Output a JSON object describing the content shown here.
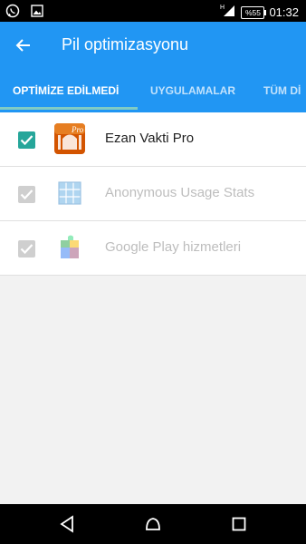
{
  "status_bar": {
    "time": "01:32",
    "battery": "%55",
    "icons": [
      "whatsapp-icon",
      "image-icon",
      "signal-icon",
      "battery-icon"
    ]
  },
  "app_bar": {
    "title": "Pil optimizasyonu",
    "back_icon": "arrow-left-icon",
    "color": "#2196f3"
  },
  "tabs": [
    {
      "label": "OPTİMİZE EDİLMEDİ",
      "active": true
    },
    {
      "label": "UYGULAMALAR",
      "active": false
    },
    {
      "label": "TÜM Dİ",
      "active": false
    }
  ],
  "apps": [
    {
      "name": "Ezan Vakti Pro",
      "checked": true,
      "enabled": true,
      "icon": "ezan-vakti-pro-icon"
    },
    {
      "name": "Anonymous Usage Stats",
      "checked": true,
      "enabled": false,
      "icon": "usage-stats-icon"
    },
    {
      "name": "Google Play hizmetleri",
      "checked": true,
      "enabled": false,
      "icon": "google-play-services-icon"
    }
  ],
  "nav_bar": {
    "buttons": [
      "back-triangle-icon",
      "home-circle-icon",
      "recents-square-icon"
    ]
  }
}
